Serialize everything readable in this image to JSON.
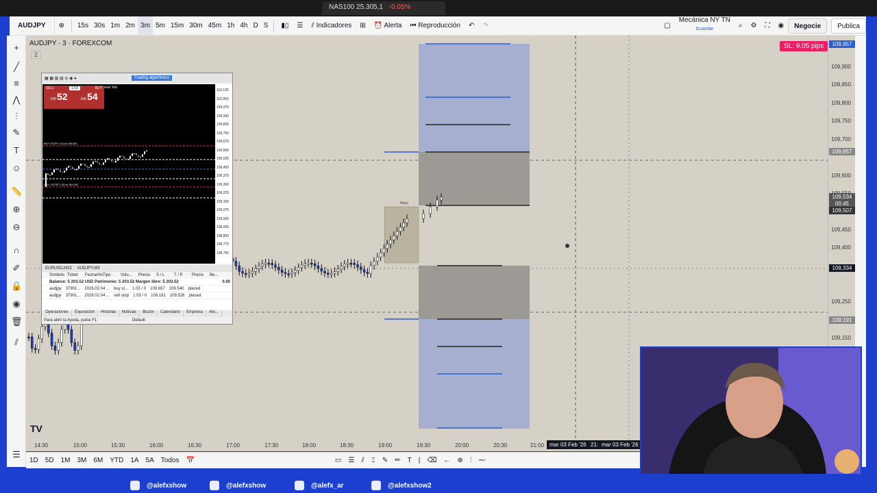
{
  "browser_tab": {
    "symbol": "NAS100",
    "price": "25.305,1",
    "change": "-0.05%"
  },
  "toolbar": {
    "symbol": "AUDJPY",
    "intervals": [
      "15s",
      "30s",
      "1m",
      "2m",
      "3m",
      "5m",
      "15m",
      "30m",
      "45m",
      "1h",
      "4h",
      "D",
      "S"
    ],
    "active_interval": "3m",
    "indicators_label": "Indicadores",
    "alert_label": "Alerta",
    "replay_label": "Reproducción",
    "layout_name": "Mecánica NY TN",
    "layout_saved": "Guardar",
    "trade_label": "Negocie",
    "publish_label": "Publica"
  },
  "chart": {
    "title": "AUDJPY · 3 · FOREXCOM",
    "sub_count": "2",
    "sl_badge": "SL: 9.05 pips",
    "price_ticks": [
      "109,900",
      "109,850",
      "109,800",
      "109,750",
      "109,700",
      "109,600",
      "109,550",
      "109,450",
      "109,400",
      "109,250",
      "109,200",
      "109,150"
    ],
    "price_tags": {
      "top": "109,957",
      "entry": "109,657",
      "current": "109,534",
      "countdown": "00:45",
      "bid": "109,507",
      "crosshair": "109,334",
      "lower": "109,191"
    },
    "time_ticks": [
      "14:30",
      "15:00",
      "15:30",
      "16:00",
      "16:30",
      "17:00",
      "17:30",
      "18:00",
      "18:30",
      "19:00",
      "19:30",
      "20:00",
      "20:30",
      "21:00"
    ],
    "time_tags": [
      "mar 03 Feb '26",
      "21:",
      "mar 03 Feb '26"
    ],
    "session_label": "Tokyo"
  },
  "bottom_bar": {
    "ranges": [
      "1D",
      "5D",
      "1M",
      "3M",
      "6M",
      "YTD",
      "1A",
      "5A",
      "Todos"
    ]
  },
  "metatrader": {
    "algo_button": "Trading algorítmico",
    "chart_title": "AUDJPY, M3: Australian Dollar vs Japanese Yen",
    "sell_label": "SELL",
    "buy_label": "BUY",
    "lot": "1.03",
    "sell_price_prefix": "109",
    "sell_price": "52",
    "buy_price_prefix": "109",
    "buy_price": "54",
    "buy_stop_line": "BUY STOP 1.03 at 109.657",
    "sell_stop_line": "SELL STOP 1.03 at 109.191",
    "tabs_window": [
      "EURUSD,M15",
      "AUDJPY,M3"
    ],
    "columns": [
      "Símbolo",
      "Ticket",
      "Fecha/Hora",
      "Tipo",
      "Volu...",
      "Precio",
      "S / L",
      "T / P",
      "Precio",
      "Be..."
    ],
    "balance_row": "Balance: 5 203.52 USD  Patrimonio: 5 203.52  Margen libre: 5 203.52",
    "balance_val": "0.00",
    "orders": [
      {
        "sym": "audjpy",
        "ticket": "37901...",
        "date": "2026.02.04 ...",
        "type": "buy st...",
        "vol": "1.03 / 0",
        "price": "109.657",
        "sl": "109.540",
        "state": "placed"
      },
      {
        "sym": "audjpy",
        "ticket": "37901...",
        "date": "2026.02.04 ...",
        "type": "sell stop",
        "vol": "1.03 / 0",
        "price": "109.191",
        "sl": "109.526",
        "state": "placed"
      }
    ],
    "bottom_tabs": [
      "Operaciones",
      "Exposición",
      "Historial",
      "Noticias",
      "Buzón",
      "Calendario",
      "Empresa",
      "Ale..."
    ],
    "help_text": "Para abrir la Ayuda, pulse F1",
    "profile": "Default",
    "axis_ticks": [
      "110,125",
      "110,050",
      "109,975",
      "109,900",
      "109,825",
      "109,750",
      "109,675",
      "109,600",
      "109,525",
      "109,450",
      "109,375",
      "109,300",
      "109,225",
      "109,150",
      "109,075",
      "109,000",
      "108,925",
      "108,850",
      "108,775",
      "108,700"
    ]
  },
  "social": [
    {
      "icon": "tiktok-icon",
      "handle": "@alefxshow"
    },
    {
      "icon": "x-icon",
      "handle": "@alefxshow"
    },
    {
      "icon": "instagram-icon",
      "handle": "@alefx_ar"
    },
    {
      "icon": "youtube-icon",
      "handle": "@alefxshow2"
    }
  ],
  "colors": {
    "frame": "#1c3fd0",
    "chart_bg": "#d6d1c7",
    "zone_blue": "#a6afcf",
    "zone_gray": "#9d9a95",
    "line_blue": "#2a5bd7",
    "sl_badge": "#e91e63"
  }
}
